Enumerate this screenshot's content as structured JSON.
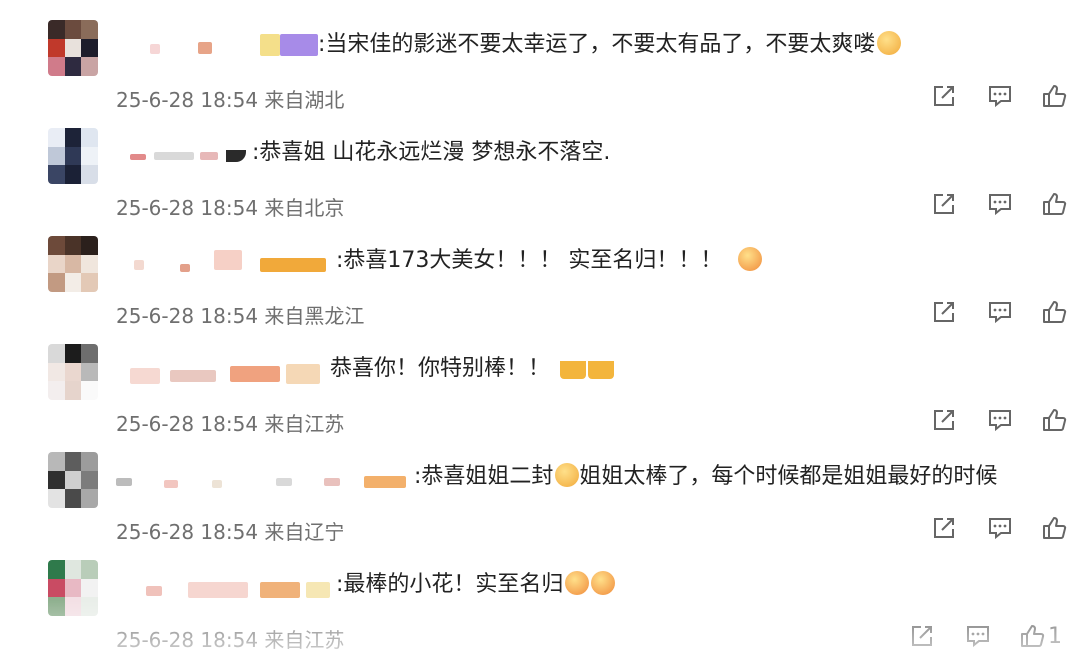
{
  "icons": {
    "share": "share-icon",
    "comment": "comment-icon",
    "like": "thumbs-up-icon"
  },
  "comments": [
    {
      "text": ":当宋佳的影迷不要太幸运了，不要太有品了，不要太爽喽",
      "meta": "25-6-28 18:54 来自湖北",
      "emoji": "smiley-emoji"
    },
    {
      "text": ":恭喜姐 山花永远烂漫 梦想永不落空.",
      "meta": "25-6-28 18:54 来自北京"
    },
    {
      "text": ":恭喜173大美女！！！ 实至名归！！！",
      "meta": "25-6-28 18:54 来自黑龙江",
      "emoji": "heart-eyes-emoji"
    },
    {
      "text": "恭喜你！你特别棒！！",
      "meta": "25-6-28 18:54 来自江苏",
      "emoji": "cheers-emoji"
    },
    {
      "text": ":恭喜姐姐二封",
      "text2": "姐姐太棒了，每个时候都是姐姐最好的时候",
      "meta": "25-6-28 18:54 来自辽宁",
      "emoji": "crying-emoji"
    },
    {
      "text": ":最棒的小花！实至名归",
      "meta": "25-6-28 18:54 来自江苏",
      "emoji": "crying-emoji",
      "like_count": "1"
    }
  ]
}
